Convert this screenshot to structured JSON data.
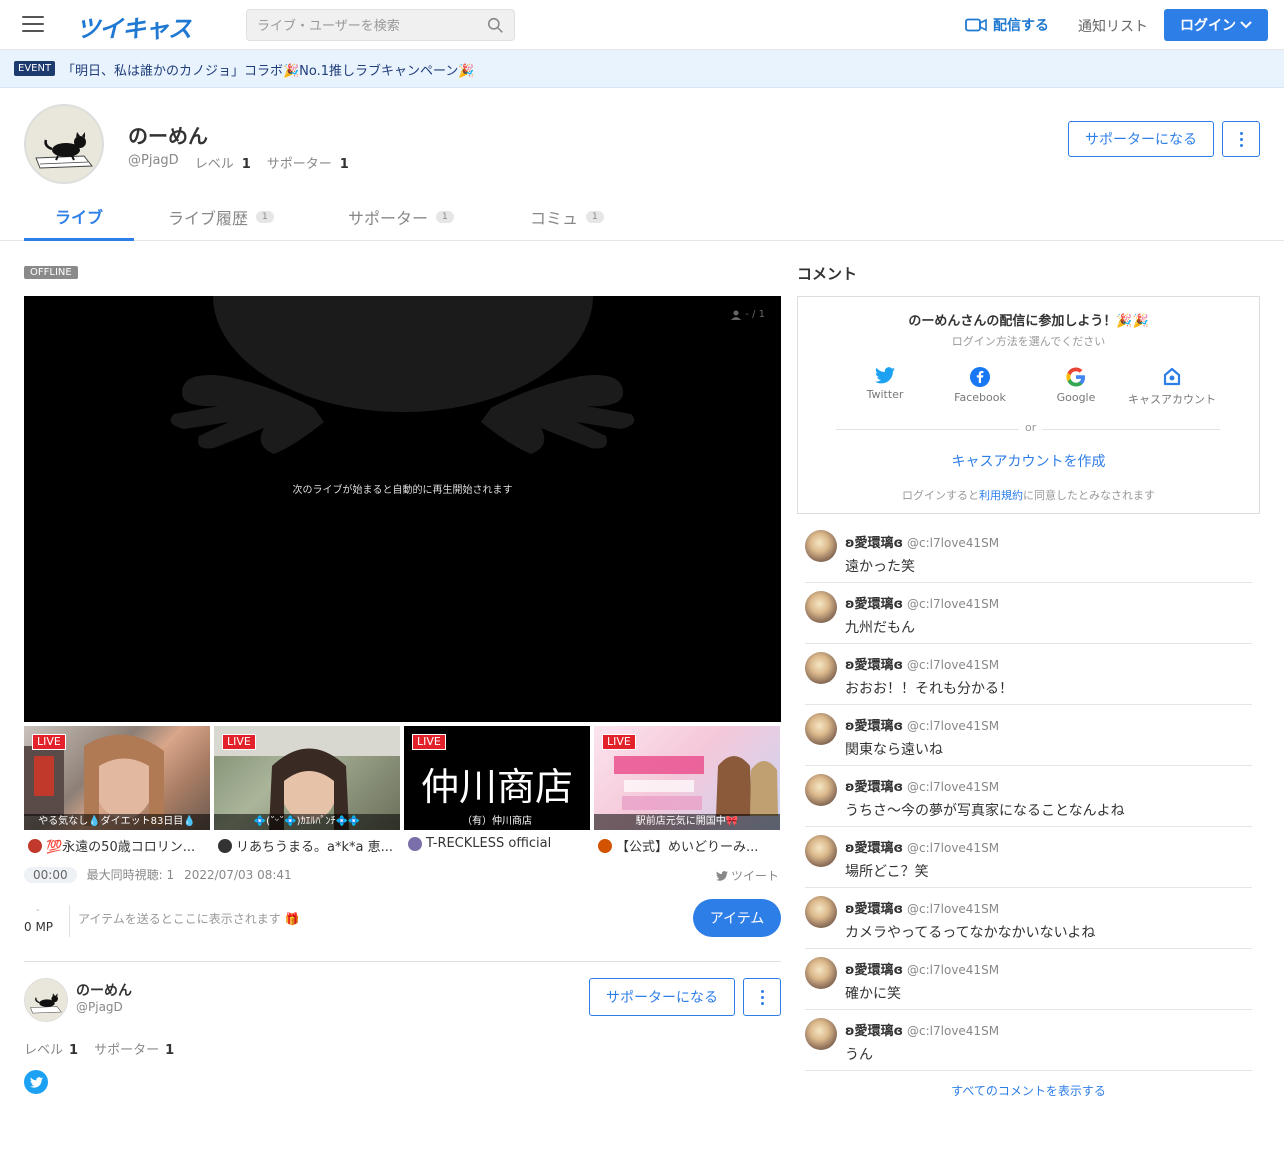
{
  "header": {
    "logo": "ツイキャス",
    "search_placeholder": "ライブ・ユーザーを検索",
    "broadcast_label": "配信する",
    "notify_label": "通知リスト",
    "login_label": "ログイン"
  },
  "event": {
    "badge": "EVENT",
    "text": "「明日、私は誰かのカノジョ」コラボ🎉No.1推しラブキャンペーン🎉"
  },
  "profile": {
    "name": "のーめん",
    "handle": "@PjagD",
    "level_label": "レベル",
    "level": "1",
    "supporter_label": "サポーター",
    "supporters": "1",
    "supporter_button": "サポーターになる"
  },
  "tabs": [
    {
      "label": "ライブ",
      "count": ""
    },
    {
      "label": "ライブ履歴",
      "count": "1"
    },
    {
      "label": "サポーター",
      "count": "1"
    },
    {
      "label": "コミュ",
      "count": "1"
    }
  ],
  "player": {
    "status": "OFFLINE",
    "viewers": "- / 1",
    "message": "次のライブが始まると自動的に再生開始されます"
  },
  "live_thumbs": [
    {
      "badge": "LIVE",
      "caption": "やる気なし💧ダイエット83日目💧",
      "title": "💯永遠の50歳コロリン...",
      "icon_color": "#c0392b"
    },
    {
      "badge": "LIVE",
      "caption": "💠(˘ᵕ˘💠)ｶｴﾙﾊﾟﾝﾁ💠💠",
      "title": "リあちうまる。a*k*a 恵...",
      "icon_color": "#333333"
    },
    {
      "badge": "LIVE",
      "caption": "（有）仲川商店",
      "title": "T-RECKLESS official",
      "icon_color": "#7a6fa8",
      "image_text": "仲川商店"
    },
    {
      "badge": "LIVE",
      "caption": "駅前店元気に開国中🎀",
      "title": "【公式】めいどりーみ...",
      "icon_color": "#d35400"
    }
  ],
  "stats": {
    "time": "00:00",
    "max_viewers": "最大同時視聴: 1",
    "date": "2022/07/03 08:41",
    "tweet_label": "ツイート"
  },
  "items": {
    "dash": "-",
    "mp": "0 MP",
    "message": "アイテムを送るとここに表示されます 🎁",
    "button": "アイテム"
  },
  "comments_section": {
    "heading": "コメント",
    "login_title": "のーめんさんの配信に参加しよう！🎉🎉",
    "login_sub": "ログイン方法を選んでください",
    "sso": [
      {
        "label": "Twitter",
        "icon": "twitter-icon"
      },
      {
        "label": "Facebook",
        "icon": "facebook-icon"
      },
      {
        "label": "Google",
        "icon": "google-icon"
      },
      {
        "label": "キャスアカウント",
        "icon": "cas-account-icon"
      }
    ],
    "or": "or",
    "create_account": "キャスアカウントを作成",
    "terms_prefix": "ログインすると",
    "terms_link": "利用規約",
    "terms_suffix": "に同意したとみなされます",
    "show_all": "すべてのコメントを表示する",
    "list": [
      {
        "name": "ʚ愛環璃ɞ",
        "handle": "@c:l7love41SM",
        "text": "遠かった笑"
      },
      {
        "name": "ʚ愛環璃ɞ",
        "handle": "@c:l7love41SM",
        "text": "九州だもん"
      },
      {
        "name": "ʚ愛環璃ɞ",
        "handle": "@c:l7love41SM",
        "text": "おおお！！それも分かる！"
      },
      {
        "name": "ʚ愛環璃ɞ",
        "handle": "@c:l7love41SM",
        "text": "関東なら遠いね"
      },
      {
        "name": "ʚ愛環璃ɞ",
        "handle": "@c:l7love41SM",
        "text": "うちさ〜今の夢が写真家になることなんよね"
      },
      {
        "name": "ʚ愛環璃ɞ",
        "handle": "@c:l7love41SM",
        "text": "場所どこ？笑"
      },
      {
        "name": "ʚ愛環璃ɞ",
        "handle": "@c:l7love41SM",
        "text": "カメラやってるってなかなかいないよね"
      },
      {
        "name": "ʚ愛環璃ɞ",
        "handle": "@c:l7love41SM",
        "text": "確かに笑"
      },
      {
        "name": "ʚ愛環璃ɞ",
        "handle": "@c:l7love41SM",
        "text": "うん"
      }
    ]
  },
  "colors": {
    "accent": "#2e7ee8",
    "live": "#e3212b"
  }
}
